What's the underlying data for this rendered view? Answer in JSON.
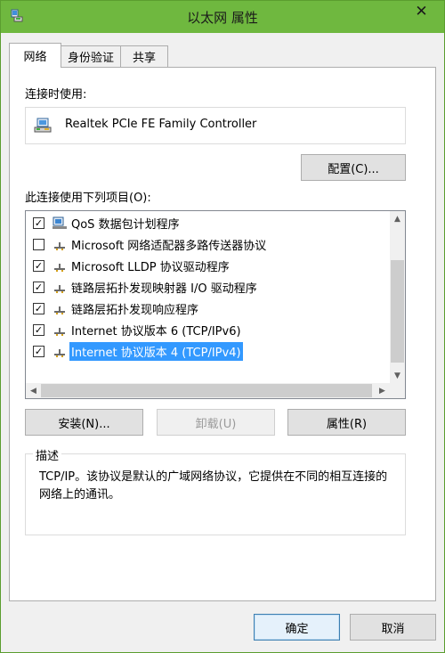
{
  "window": {
    "title": "以太网 属性",
    "close_glyph": "✕"
  },
  "tabs": [
    {
      "label": "网络",
      "active": true
    },
    {
      "label": "身份验证",
      "active": false
    },
    {
      "label": "共享",
      "active": false
    }
  ],
  "connect_using_label": "连接时使用:",
  "adapter": {
    "name": "Realtek PCIe FE Family Controller",
    "icon": "network-adapter-icon"
  },
  "configure_button": "配置(C)...",
  "items_label": "此连接使用下列项目(O):",
  "items": [
    {
      "label": "QoS 数据包计划程序",
      "checked": true,
      "icon": "qos-scheduler-icon",
      "selected": false
    },
    {
      "label": "Microsoft 网络适配器多路传送器协议",
      "checked": false,
      "icon": "protocol-icon",
      "selected": false
    },
    {
      "label": "Microsoft LLDP 协议驱动程序",
      "checked": true,
      "icon": "protocol-icon",
      "selected": false
    },
    {
      "label": "链路层拓扑发现映射器 I/O 驱动程序",
      "checked": true,
      "icon": "protocol-icon",
      "selected": false
    },
    {
      "label": "链路层拓扑发现响应程序",
      "checked": true,
      "icon": "protocol-icon",
      "selected": false
    },
    {
      "label": "Internet 协议版本 6 (TCP/IPv6)",
      "checked": true,
      "icon": "protocol-icon",
      "selected": false
    },
    {
      "label": "Internet 协议版本 4 (TCP/IPv4)",
      "checked": true,
      "icon": "protocol-icon",
      "selected": true
    }
  ],
  "buttons": {
    "install": "安装(N)...",
    "uninstall": "卸载(U)",
    "properties": "属性(R)"
  },
  "description": {
    "title": "描述",
    "text": "TCP/IP。该协议是默认的广域网络协议，它提供在不同的相互连接的网络上的通讯。"
  },
  "footer": {
    "ok": "确定",
    "cancel": "取消"
  },
  "colors": {
    "titlebar": "#6fb83f",
    "selection": "#3399ff",
    "focus_border": "#3c7fb1"
  }
}
